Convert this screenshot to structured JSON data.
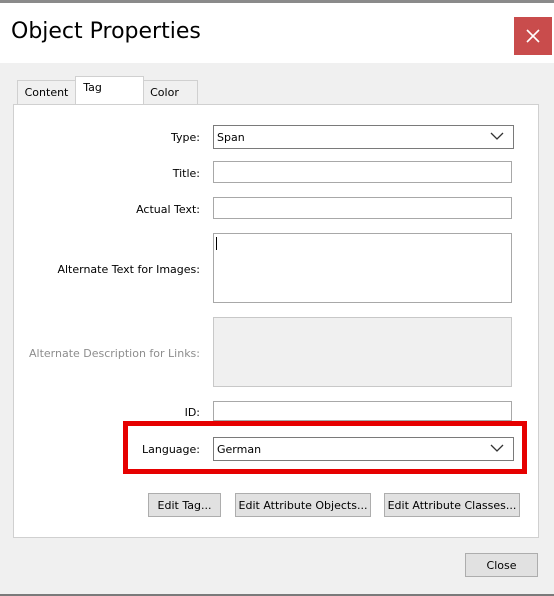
{
  "window": {
    "title": "Object Properties"
  },
  "tabs": [
    {
      "label": "Content"
    },
    {
      "label": "Tag"
    },
    {
      "label": "Color"
    }
  ],
  "form": {
    "type": {
      "label": "Type:",
      "value": "Span"
    },
    "title": {
      "label": "Title:",
      "value": ""
    },
    "actual_text": {
      "label": "Actual Text:",
      "value": ""
    },
    "alt_text": {
      "label": "Alternate Text for Images:",
      "value": ""
    },
    "alt_desc": {
      "label": "Alternate Description for Links:",
      "value": ""
    },
    "id": {
      "label": "ID:",
      "value": ""
    },
    "language": {
      "label": "Language:",
      "value": "German"
    }
  },
  "buttons": {
    "edit_tag": "Edit Tag...",
    "edit_attr_objects": "Edit Attribute Objects...",
    "edit_attr_classes": "Edit Attribute Classes...",
    "close": "Close"
  },
  "colors": {
    "close_button_bg": "#c94c4c",
    "highlight": "#e60000"
  }
}
